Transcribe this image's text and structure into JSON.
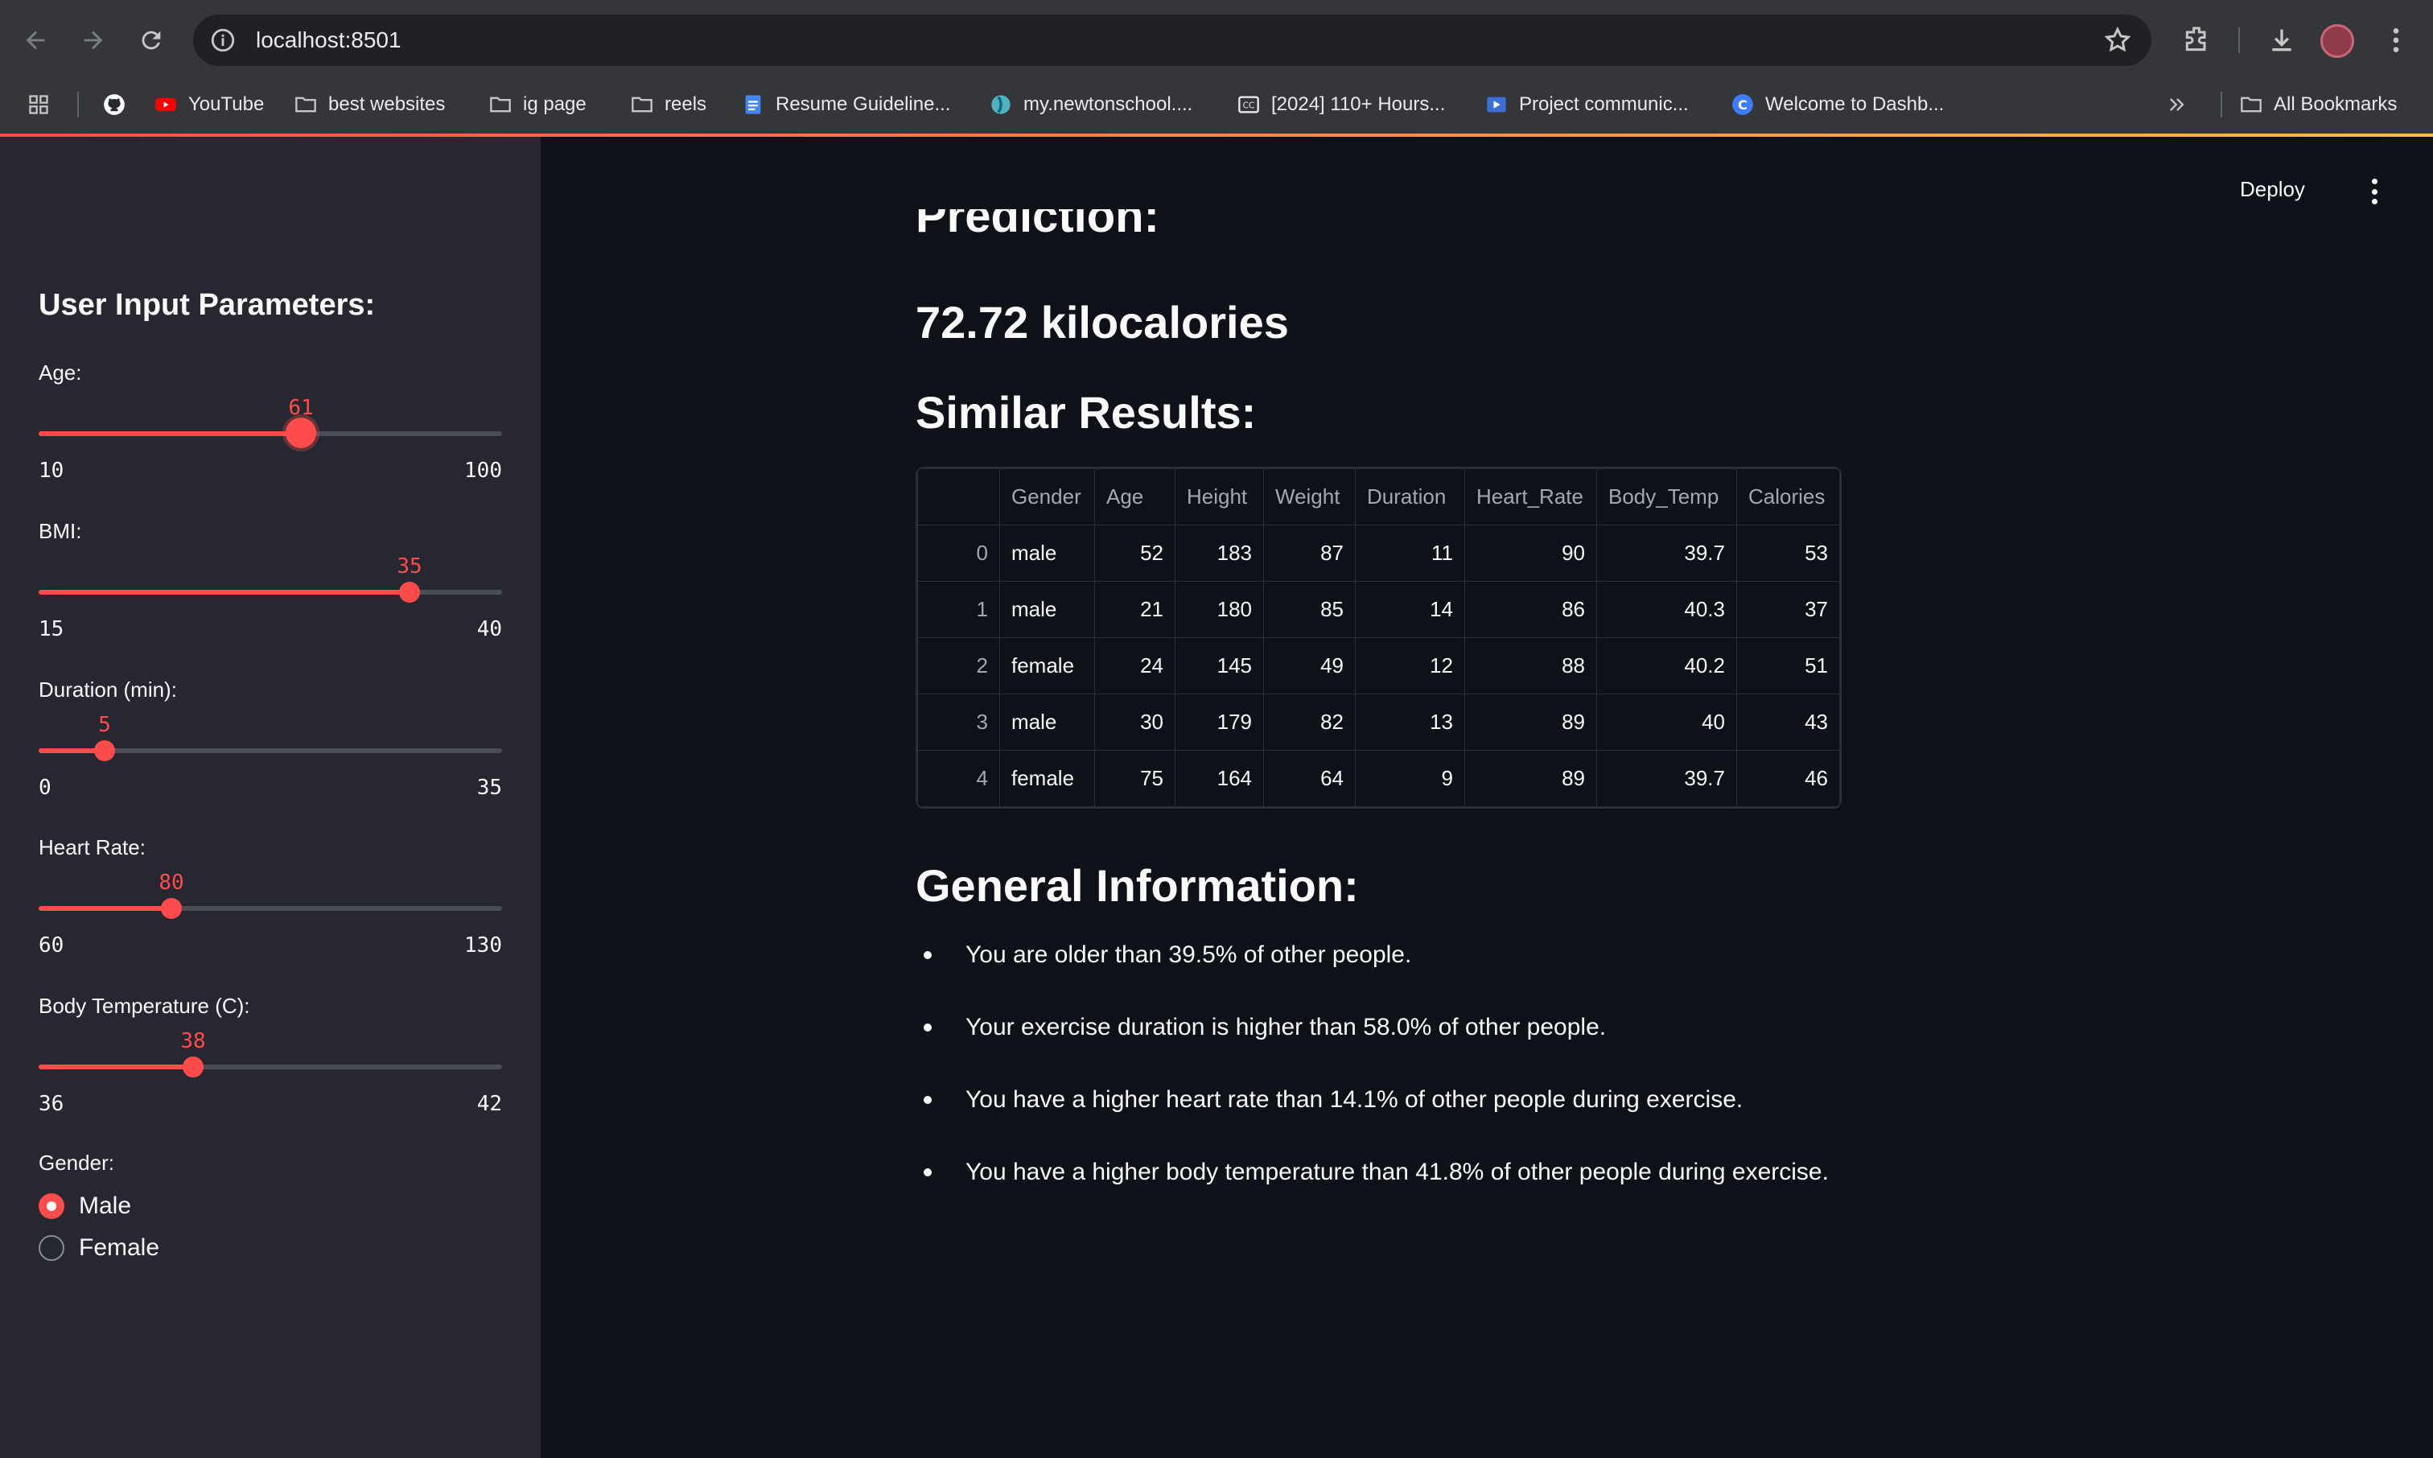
{
  "browser": {
    "url": "localhost:8501",
    "bookmarks": [
      {
        "label": "",
        "icon": "github-icon"
      },
      {
        "label": "YouTube",
        "icon": "youtube-icon"
      },
      {
        "label": "best websites",
        "icon": "folder-icon"
      },
      {
        "label": "ig page",
        "icon": "folder-icon"
      },
      {
        "label": "reels",
        "icon": "folder-icon"
      },
      {
        "label": "Resume Guideline...",
        "icon": "docs-icon"
      },
      {
        "label": "my.newtonschool....",
        "icon": "newton-icon"
      },
      {
        "label": "[2024] 110+ Hours...",
        "icon": "cc-icon"
      },
      {
        "label": "Project communic...",
        "icon": "video-icon"
      },
      {
        "label": "Welcome to Dashb...",
        "icon": "c-icon"
      }
    ],
    "all_bookmarks": "All Bookmarks"
  },
  "sidebar": {
    "title": "User Input Parameters:",
    "sliders": [
      {
        "label": "Age:",
        "value": "61",
        "min": "10",
        "max": "100"
      },
      {
        "label": "BMI:",
        "value": "35",
        "min": "15",
        "max": "40"
      },
      {
        "label": "Duration (min):",
        "value": "5",
        "min": "0",
        "max": "35"
      },
      {
        "label": "Heart Rate:",
        "value": "80",
        "min": "60",
        "max": "130"
      },
      {
        "label": "Body Temperature (C):",
        "value": "38",
        "min": "36",
        "max": "42"
      }
    ],
    "gender": {
      "label": "Gender:",
      "options": [
        "Male",
        "Female"
      ],
      "selected": "Male"
    }
  },
  "header": {
    "deploy": "Deploy"
  },
  "main": {
    "cut_heading": "Prediction:",
    "prediction": "72.72 kilocalories",
    "similar_heading": "Similar Results:",
    "table": {
      "columns": [
        "",
        "Gender",
        "Age",
        "Height",
        "Weight",
        "Duration",
        "Heart_Rate",
        "Body_Temp",
        "Calories"
      ],
      "rows": [
        [
          "0",
          "male",
          "52",
          "183",
          "87",
          "11",
          "90",
          "39.7",
          "53"
        ],
        [
          "1",
          "male",
          "21",
          "180",
          "85",
          "14",
          "86",
          "40.3",
          "37"
        ],
        [
          "2",
          "female",
          "24",
          "145",
          "49",
          "12",
          "88",
          "40.2",
          "51"
        ],
        [
          "3",
          "male",
          "30",
          "179",
          "82",
          "13",
          "89",
          "40",
          "43"
        ],
        [
          "4",
          "female",
          "75",
          "164",
          "64",
          "9",
          "89",
          "39.7",
          "46"
        ]
      ]
    },
    "general_heading": "General Information:",
    "info": [
      "You are older than 39.5% of other people.",
      "Your exercise duration is higher than 58.0% of other people.",
      "You have a higher heart rate than 14.1% of other people during exercise.",
      "You have a higher body temperature than 41.8% of other people during exercise."
    ]
  },
  "colors": {
    "accent": "#ff4b4b",
    "sidebar_bg": "#262730",
    "main_bg": "#0e1117"
  }
}
